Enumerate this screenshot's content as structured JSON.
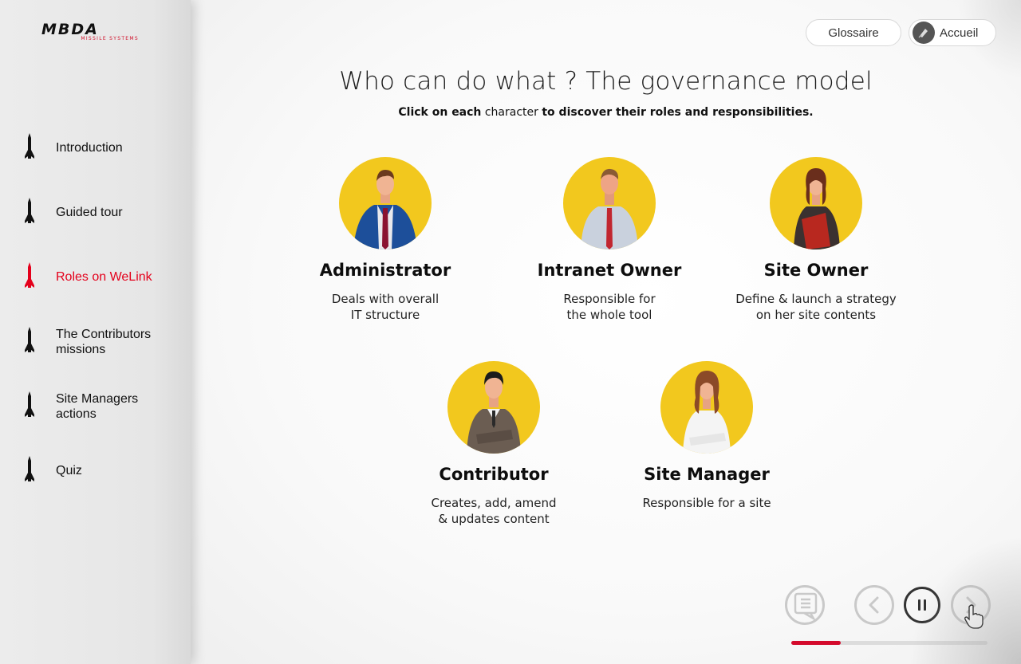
{
  "brand": {
    "name": "MBDA",
    "tagline": "MISSILE SYSTEMS",
    "accent": "#e4001b"
  },
  "sidebar": {
    "items": [
      {
        "label": "Introduction",
        "active": false
      },
      {
        "label": "Guided tour",
        "active": false
      },
      {
        "label": "Roles on WeLink",
        "active": true
      },
      {
        "label": "The Contributors\nmissions",
        "active": false
      },
      {
        "label": "Site Managers\nactions",
        "active": false
      },
      {
        "label": "Quiz",
        "active": false
      }
    ]
  },
  "header": {
    "glossary_label": "Glossaire",
    "home_label": "Accueil"
  },
  "main": {
    "title": "Who can do what ? The governance model",
    "subtitle_bold_1": "Click on each",
    "subtitle_light": "character",
    "subtitle_bold_2": "to discover their roles and responsibilities."
  },
  "characters": [
    {
      "name": "Administrator",
      "desc": "Deals with overall\nIT structure"
    },
    {
      "name": "Intranet Owner",
      "desc": "Responsible for\nthe whole tool"
    },
    {
      "name": "Site Owner",
      "desc": "Define & launch a strategy\non her site contents"
    },
    {
      "name": "Contributor",
      "desc": "Creates, add, amend\n& updates content"
    },
    {
      "name": "Site Manager",
      "desc": "Responsible for a site"
    }
  ],
  "controls": {
    "progress_fraction": 0.25,
    "icons": [
      "transcript-icon",
      "previous-icon",
      "pause-icon",
      "next-icon"
    ]
  },
  "colors": {
    "avatar_bg": "#f2c81e",
    "progress": "#d40a2c"
  }
}
